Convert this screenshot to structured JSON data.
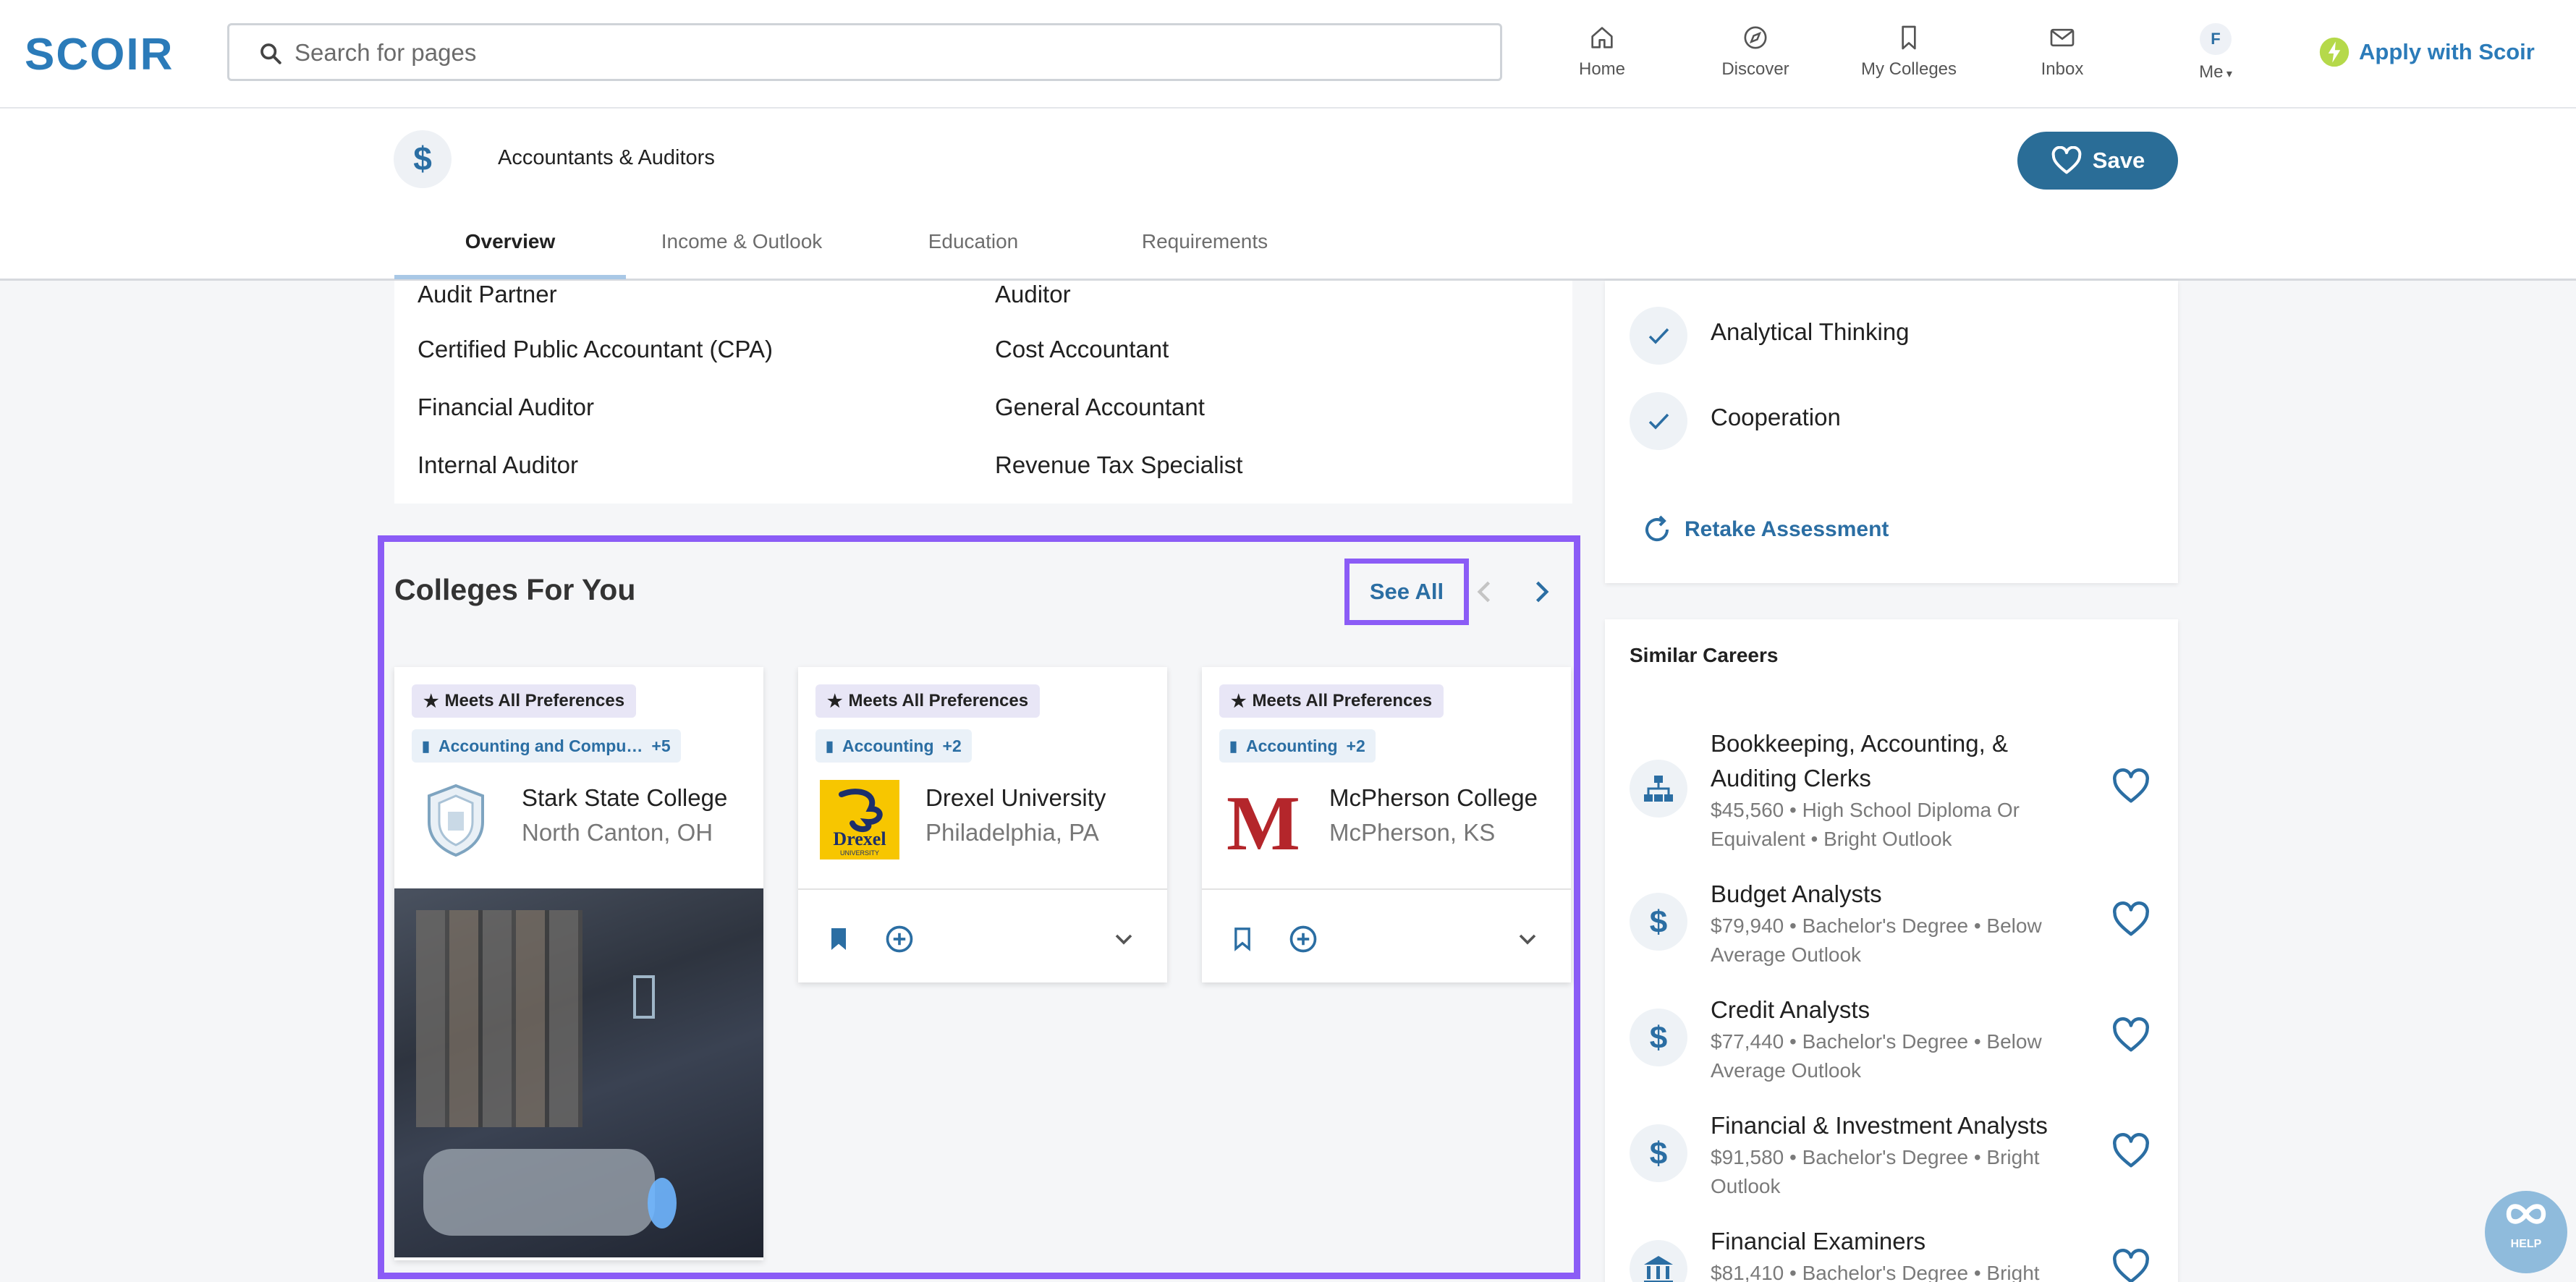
{
  "brand": {
    "logo_text": "SCOIR",
    "accent": "#2b7bb9",
    "highlight": "#8b5cf6"
  },
  "search": {
    "placeholder": "Search for pages"
  },
  "nav": {
    "home": "Home",
    "discover": "Discover",
    "my_colleges": "My Colleges",
    "inbox": "Inbox",
    "me": "Me",
    "me_initial": "F",
    "apply": "Apply with Scoir"
  },
  "career": {
    "title": "Accountants & Auditors",
    "icon": "dollar-icon",
    "save_label": "Save"
  },
  "tabs": [
    "Overview",
    "Income & Outlook",
    "Education",
    "Requirements"
  ],
  "active_tab": "Overview",
  "alt_titles": {
    "left": [
      "Audit Partner",
      "Certified Public Accountant (CPA)",
      "Financial Auditor",
      "Internal Auditor"
    ],
    "right": [
      "Auditor",
      "Cost Accountant",
      "General Accountant",
      "Revenue Tax Specialist"
    ]
  },
  "colleges": {
    "title": "Colleges For You",
    "see_all": "See All",
    "cards": [
      {
        "badge": "Meets All Preferences",
        "major": "Accounting and Compu…",
        "major_more": "+5",
        "name": "Stark State College",
        "location": "North Canton, OH",
        "logo": "shield-crest-logo"
      },
      {
        "badge": "Meets All Preferences",
        "major": "Accounting",
        "major_more": "+2",
        "name": "Drexel University",
        "location": "Philadelphia, PA",
        "logo": "drexel-dragon-logo",
        "logo_text": "Drexel",
        "logo_sub": "UNIVERSITY"
      },
      {
        "badge": "Meets All Preferences",
        "major": "Accounting",
        "major_more": "+2",
        "name": "McPherson College",
        "location": "McPherson, KS",
        "logo": "mcpherson-m-logo",
        "logo_text": "M"
      }
    ]
  },
  "skills": {
    "items": [
      "Analytical Thinking",
      "Cooperation"
    ],
    "retake": "Retake Assessment"
  },
  "similar": {
    "title": "Similar Careers",
    "items": [
      {
        "icon": "org-chart-icon",
        "title": "Bookkeeping, Accounting, & Auditing Clerks",
        "subtitle": "$45,560 • High School Diploma Or Equivalent • Bright Outlook"
      },
      {
        "icon": "dollar-icon",
        "title": "Budget Analysts",
        "subtitle": "$79,940 • Bachelor's Degree • Below Average Outlook"
      },
      {
        "icon": "dollar-icon",
        "title": "Credit Analysts",
        "subtitle": "$77,440 • Bachelor's Degree • Below Average Outlook"
      },
      {
        "icon": "dollar-icon",
        "title": "Financial & Investment Analysts",
        "subtitle": "$91,580 • Bachelor's Degree • Bright Outlook"
      },
      {
        "icon": "bank-icon",
        "title": "Financial Examiners",
        "subtitle": "$81,410 • Bachelor's Degree • Bright"
      }
    ]
  },
  "help": {
    "label": "HELP"
  }
}
